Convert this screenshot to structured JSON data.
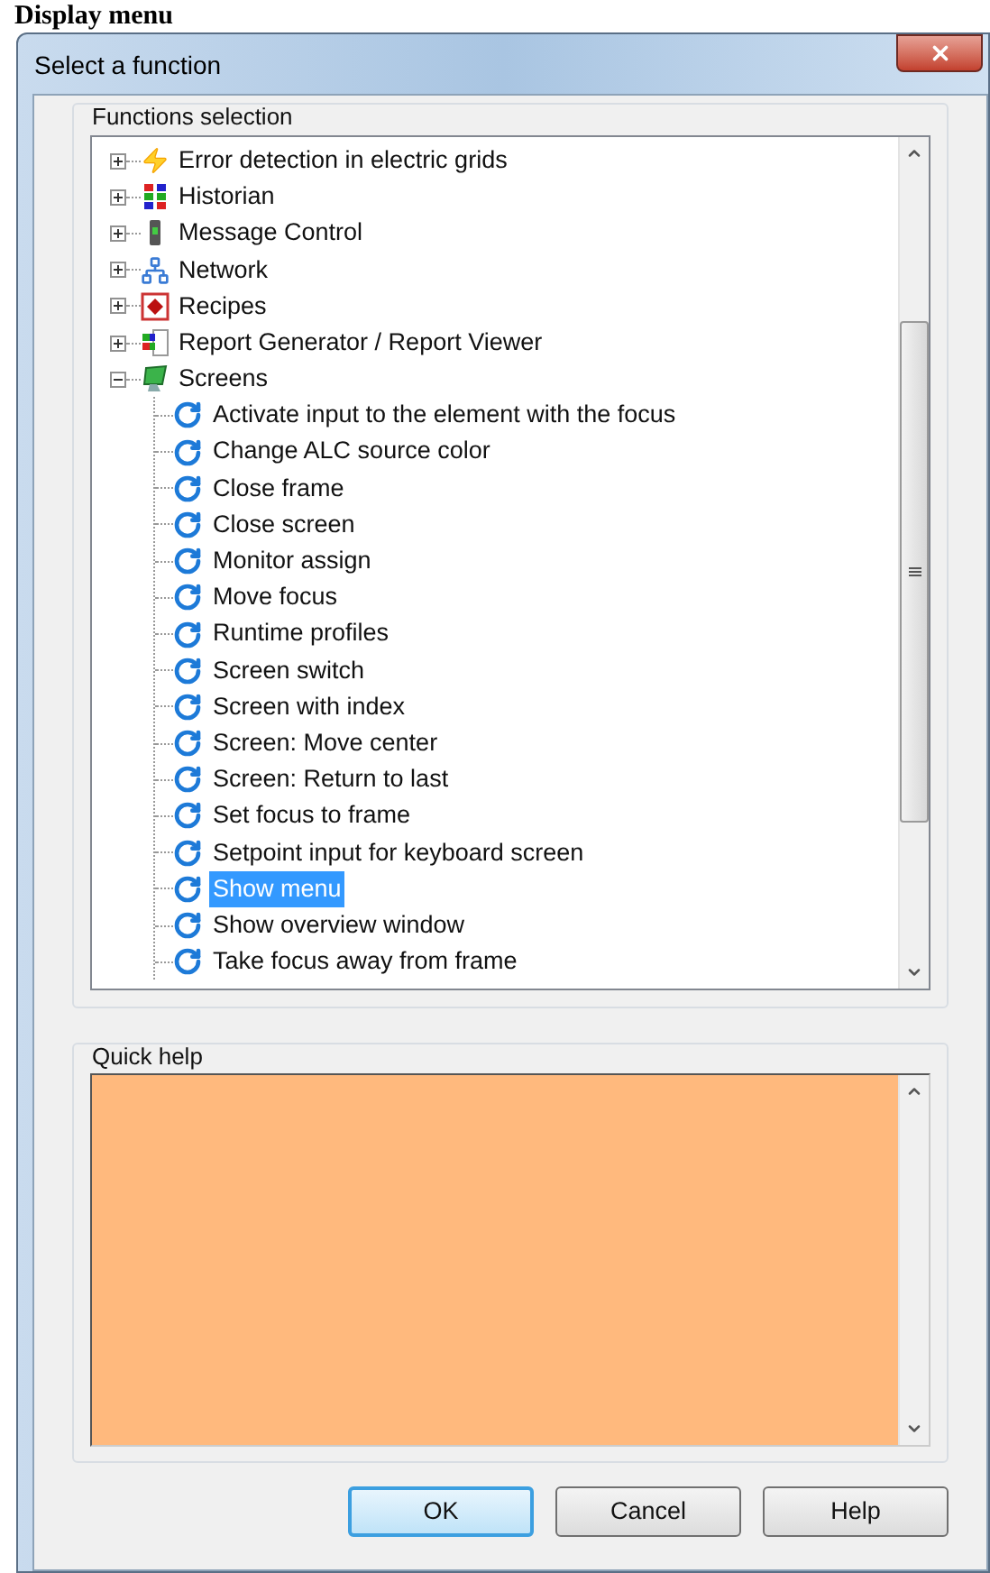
{
  "page_heading": "Display menu",
  "window": {
    "title": "Select a function"
  },
  "functions_selection": {
    "label": "Functions selection",
    "items": [
      {
        "label": "Error detection in electric grids",
        "expanded": false
      },
      {
        "label": "Historian",
        "expanded": false
      },
      {
        "label": "Message Control",
        "expanded": false
      },
      {
        "label": "Network",
        "expanded": false
      },
      {
        "label": "Recipes",
        "expanded": false
      },
      {
        "label": "Report Generator / Report Viewer",
        "expanded": false
      },
      {
        "label": "Screens",
        "expanded": true,
        "children": [
          {
            "label": "Activate input to the element with the focus",
            "selected": false
          },
          {
            "label": "Change ALC source color",
            "selected": false
          },
          {
            "label": "Close frame",
            "selected": false
          },
          {
            "label": "Close screen",
            "selected": false
          },
          {
            "label": "Monitor assign",
            "selected": false
          },
          {
            "label": "Move focus",
            "selected": false
          },
          {
            "label": "Runtime profiles",
            "selected": false
          },
          {
            "label": "Screen switch",
            "selected": false
          },
          {
            "label": "Screen with index",
            "selected": false
          },
          {
            "label": "Screen: Move center",
            "selected": false
          },
          {
            "label": "Screen: Return to last",
            "selected": false
          },
          {
            "label": "Set focus to frame",
            "selected": false
          },
          {
            "label": "Setpoint input for keyboard screen",
            "selected": false
          },
          {
            "label": "Show menu",
            "selected": true
          },
          {
            "label": "Show overview window",
            "selected": false
          },
          {
            "label": "Take focus away from frame",
            "selected": false
          }
        ]
      }
    ]
  },
  "quick_help": {
    "label": "Quick help"
  },
  "buttons": [
    {
      "label": "OK",
      "default": true
    },
    {
      "label": "Cancel",
      "default": false
    },
    {
      "label": "Help",
      "default": false
    }
  ]
}
